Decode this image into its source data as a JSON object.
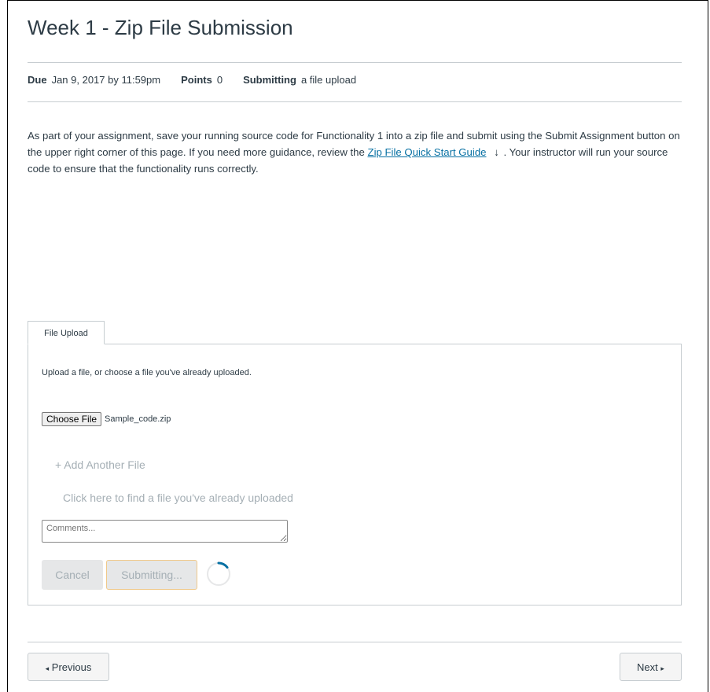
{
  "page": {
    "title": "Week 1 - Zip File Submission"
  },
  "meta": {
    "due_label": "Due",
    "due_value": "Jan 9, 2017 by 11:59pm",
    "points_label": "Points",
    "points_value": "0",
    "submitting_label": "Submitting",
    "submitting_value": "a file upload"
  },
  "description": {
    "text_before": "As part of your assignment, save your running source code for Functionality 1 into a zip file and submit using the Submit Assignment button on the upper right corner of this page. If you need more guidance, review the ",
    "link_text": "Zip File Quick Start Guide",
    "text_after": ". Your instructor will run your source code to ensure that the functionality runs correctly.",
    "download_icon": "↓"
  },
  "upload": {
    "tab_label": "File Upload",
    "intro": "Upload a file, or choose a file you've already uploaded.",
    "choose_button": "Choose File",
    "file_name": "Sample_code.zip",
    "add_another": "+ Add Another File",
    "find_uploaded": "Click here to find a file you've already uploaded",
    "comments_placeholder": "Comments...",
    "cancel_button": "Cancel",
    "submit_button": "Submitting..."
  },
  "footer": {
    "previous": "Previous",
    "next": "Next",
    "prev_arrow": "◂",
    "next_arrow": "▸"
  },
  "colors": {
    "link": "#0770a3",
    "spinner": "#0770a3",
    "submit_border": "#f0c98a"
  }
}
